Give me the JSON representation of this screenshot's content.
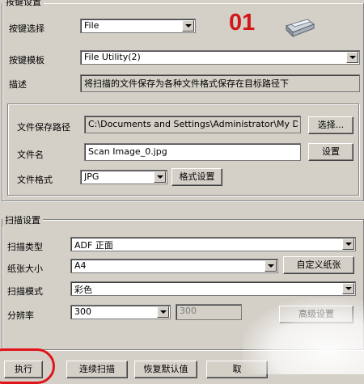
{
  "top_group": {
    "title": "按键设置",
    "key_select_label": "按键选择",
    "key_select_value": "File",
    "badge_number": "01",
    "template_label": "按键模板",
    "template_value": "File Utility(2)",
    "description_label": "描述",
    "description_value": "将扫描的文件保存为各种文件格式保存在目标路径下"
  },
  "file_group": {
    "save_path_label": "文件保存路径",
    "save_path_value": "C:\\Documents and Settings\\Administrator\\My D",
    "browse_button": "选择...",
    "file_name_label": "文件名",
    "file_name_value": "Scan Image_0.jpg",
    "settings_button": "设置",
    "file_format_label": "文件格式",
    "file_format_value": "JPG",
    "format_settings_button": "格式设置"
  },
  "scan_group": {
    "title": "扫描设置",
    "scan_type_label": "扫描类型",
    "scan_type_value": "ADF 正面",
    "paper_size_label": "纸张大小",
    "paper_size_value": "A4",
    "custom_paper_button": "自定义纸张",
    "scan_mode_label": "扫描模式",
    "scan_mode_value": "彩色",
    "resolution_label": "分辨率",
    "resolution_value": "300",
    "resolution_secondary_value": "300",
    "advanced_button": "高级设置"
  },
  "bottom_buttons": {
    "execute": "执行",
    "continuous_scan": "连续扫描",
    "restore_defaults": "恢复默认值",
    "cancel": "取"
  },
  "colors": {
    "badge_red": "#d01818",
    "highlight_circle": "#e0141a"
  }
}
